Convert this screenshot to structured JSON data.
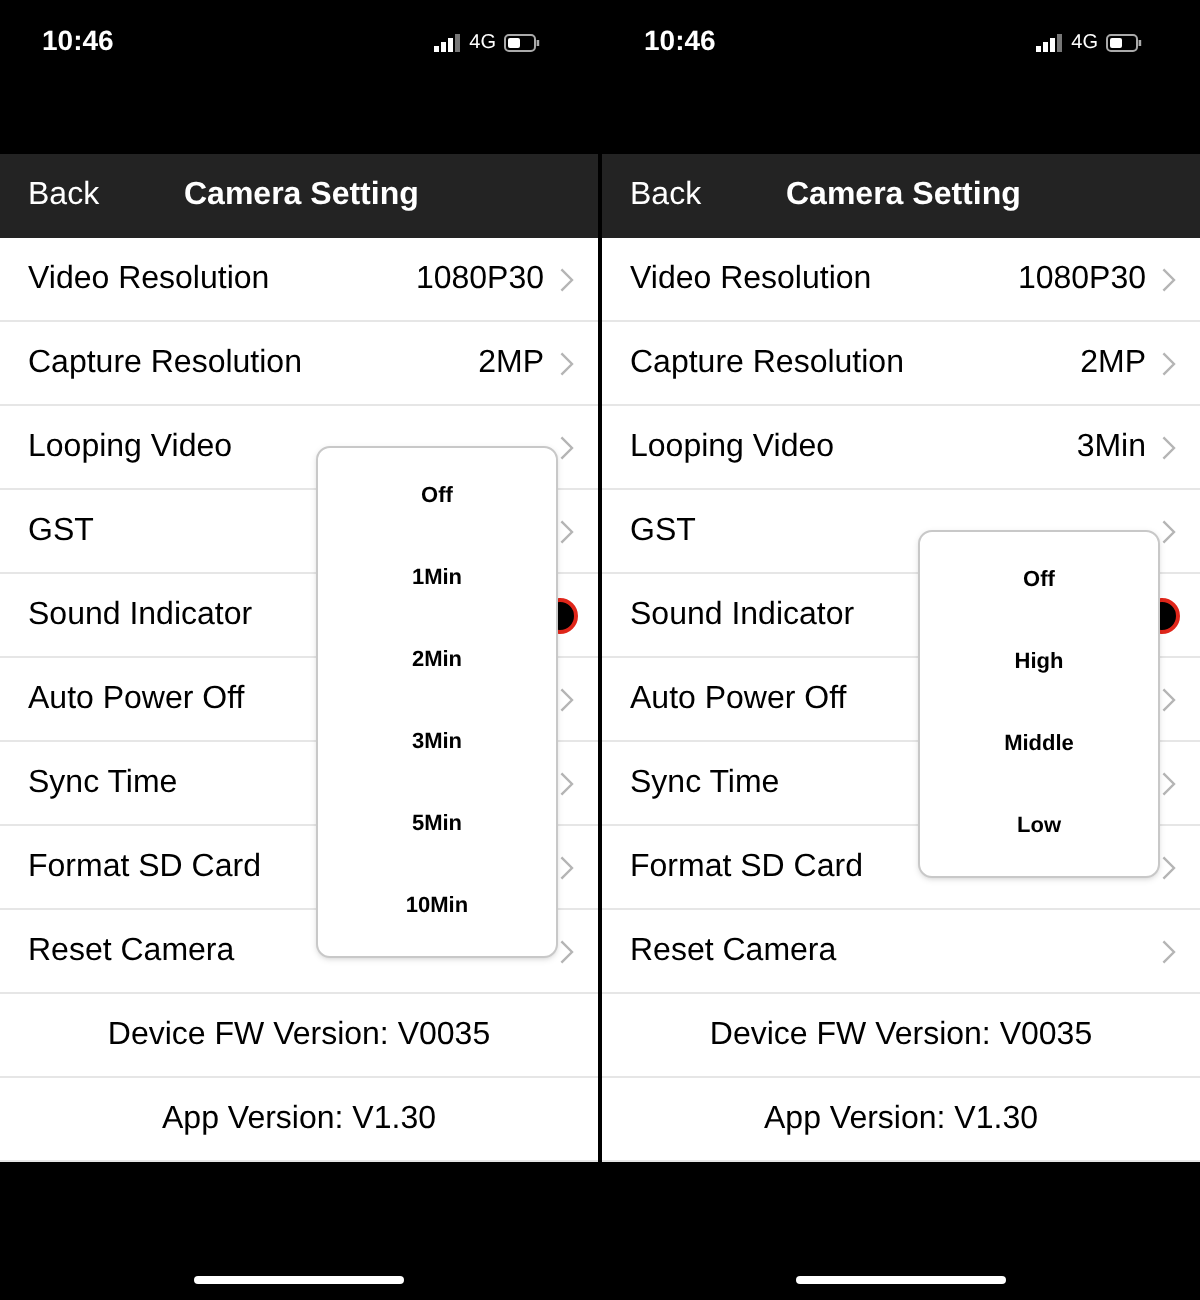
{
  "phones": [
    {
      "status_bar": {
        "time": "10:46",
        "network": "4G"
      },
      "header": {
        "back": "Back",
        "title": "Camera Setting"
      },
      "rows": [
        {
          "label": "Video Resolution",
          "value": "1080P30",
          "kind": "chevron"
        },
        {
          "label": "Capture Resolution",
          "value": "2MP",
          "kind": "chevron"
        },
        {
          "label": "Looping Video",
          "kind": "chevron",
          "popup": {
            "options": [
              "Off",
              "1Min",
              "2Min",
              "3Min",
              "5Min",
              "10Min"
            ]
          }
        },
        {
          "label": "GST",
          "kind": "chevron"
        },
        {
          "label": "Sound Indicator",
          "kind": "switch"
        },
        {
          "label": "Auto Power Off",
          "kind": "chevron"
        },
        {
          "label": "Sync Time",
          "kind": "chevron"
        },
        {
          "label": "Format SD Card",
          "kind": "chevron"
        },
        {
          "label": "Reset Camera",
          "kind": "chevron"
        }
      ],
      "info": [
        "Device FW Version: V0035",
        "App Version: V1.30"
      ]
    },
    {
      "status_bar": {
        "time": "10:46",
        "network": "4G"
      },
      "header": {
        "back": "Back",
        "title": "Camera Setting"
      },
      "rows": [
        {
          "label": "Video Resolution",
          "value": "1080P30",
          "kind": "chevron"
        },
        {
          "label": "Capture Resolution",
          "value": "2MP",
          "kind": "chevron"
        },
        {
          "label": "Looping Video",
          "value": "3Min",
          "kind": "chevron"
        },
        {
          "label": "GST",
          "kind": "chevron",
          "popup": {
            "options": [
              "Off",
              "High",
              "Middle",
              "Low"
            ]
          }
        },
        {
          "label": "Sound Indicator",
          "kind": "switch"
        },
        {
          "label": "Auto Power Off",
          "kind": "chevron"
        },
        {
          "label": "Sync Time",
          "kind": "chevron"
        },
        {
          "label": "Format SD Card",
          "kind": "chevron"
        },
        {
          "label": "Reset Camera",
          "kind": "chevron"
        }
      ],
      "info": [
        "Device FW Version: V0035",
        "App Version: V1.30"
      ]
    }
  ]
}
